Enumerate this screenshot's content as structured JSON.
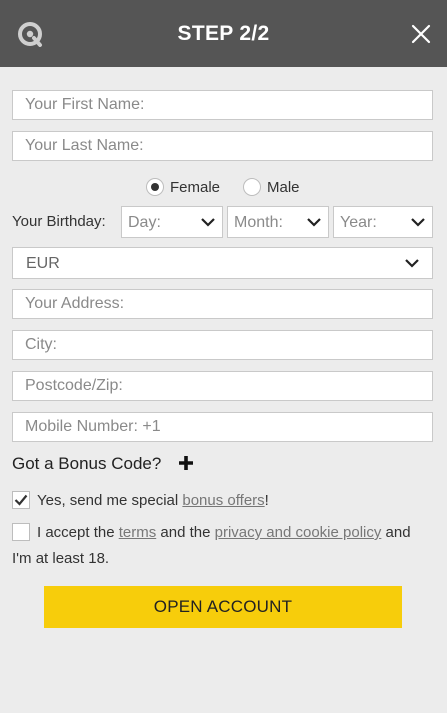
{
  "header": {
    "title": "STEP 2/2",
    "logo_icon": "q-logo-icon",
    "close_icon": "close-icon"
  },
  "form": {
    "first_name_placeholder": "Your First Name:",
    "last_name_placeholder": "Your Last Name:",
    "gender": {
      "female_label": "Female",
      "male_label": "Male",
      "selected": "Female"
    },
    "birthday": {
      "label": "Your Birthday:",
      "day": "Day:",
      "month": "Month:",
      "year": "Year:"
    },
    "currency": "EUR",
    "address_placeholder": "Your Address:",
    "city_placeholder": "City:",
    "postcode_placeholder": "Postcode/Zip:",
    "mobile_placeholder": "Mobile Number: +1",
    "bonus_code_label": "Got a Bonus Code?",
    "offers": {
      "checked": true,
      "text_before": "Yes, send me special ",
      "link": "bonus offers",
      "text_after": "!"
    },
    "terms": {
      "checked": false,
      "text_1": "I accept the ",
      "link_terms": "terms",
      "text_2": " and the ",
      "link_privacy": "privacy and cookie policy",
      "text_3": " and",
      "line2": "I'm at least 18."
    },
    "submit_label": "OPEN ACCOUNT"
  },
  "colors": {
    "header_bg": "#555555",
    "background": "#ececec",
    "button": "#f7cd0b"
  }
}
